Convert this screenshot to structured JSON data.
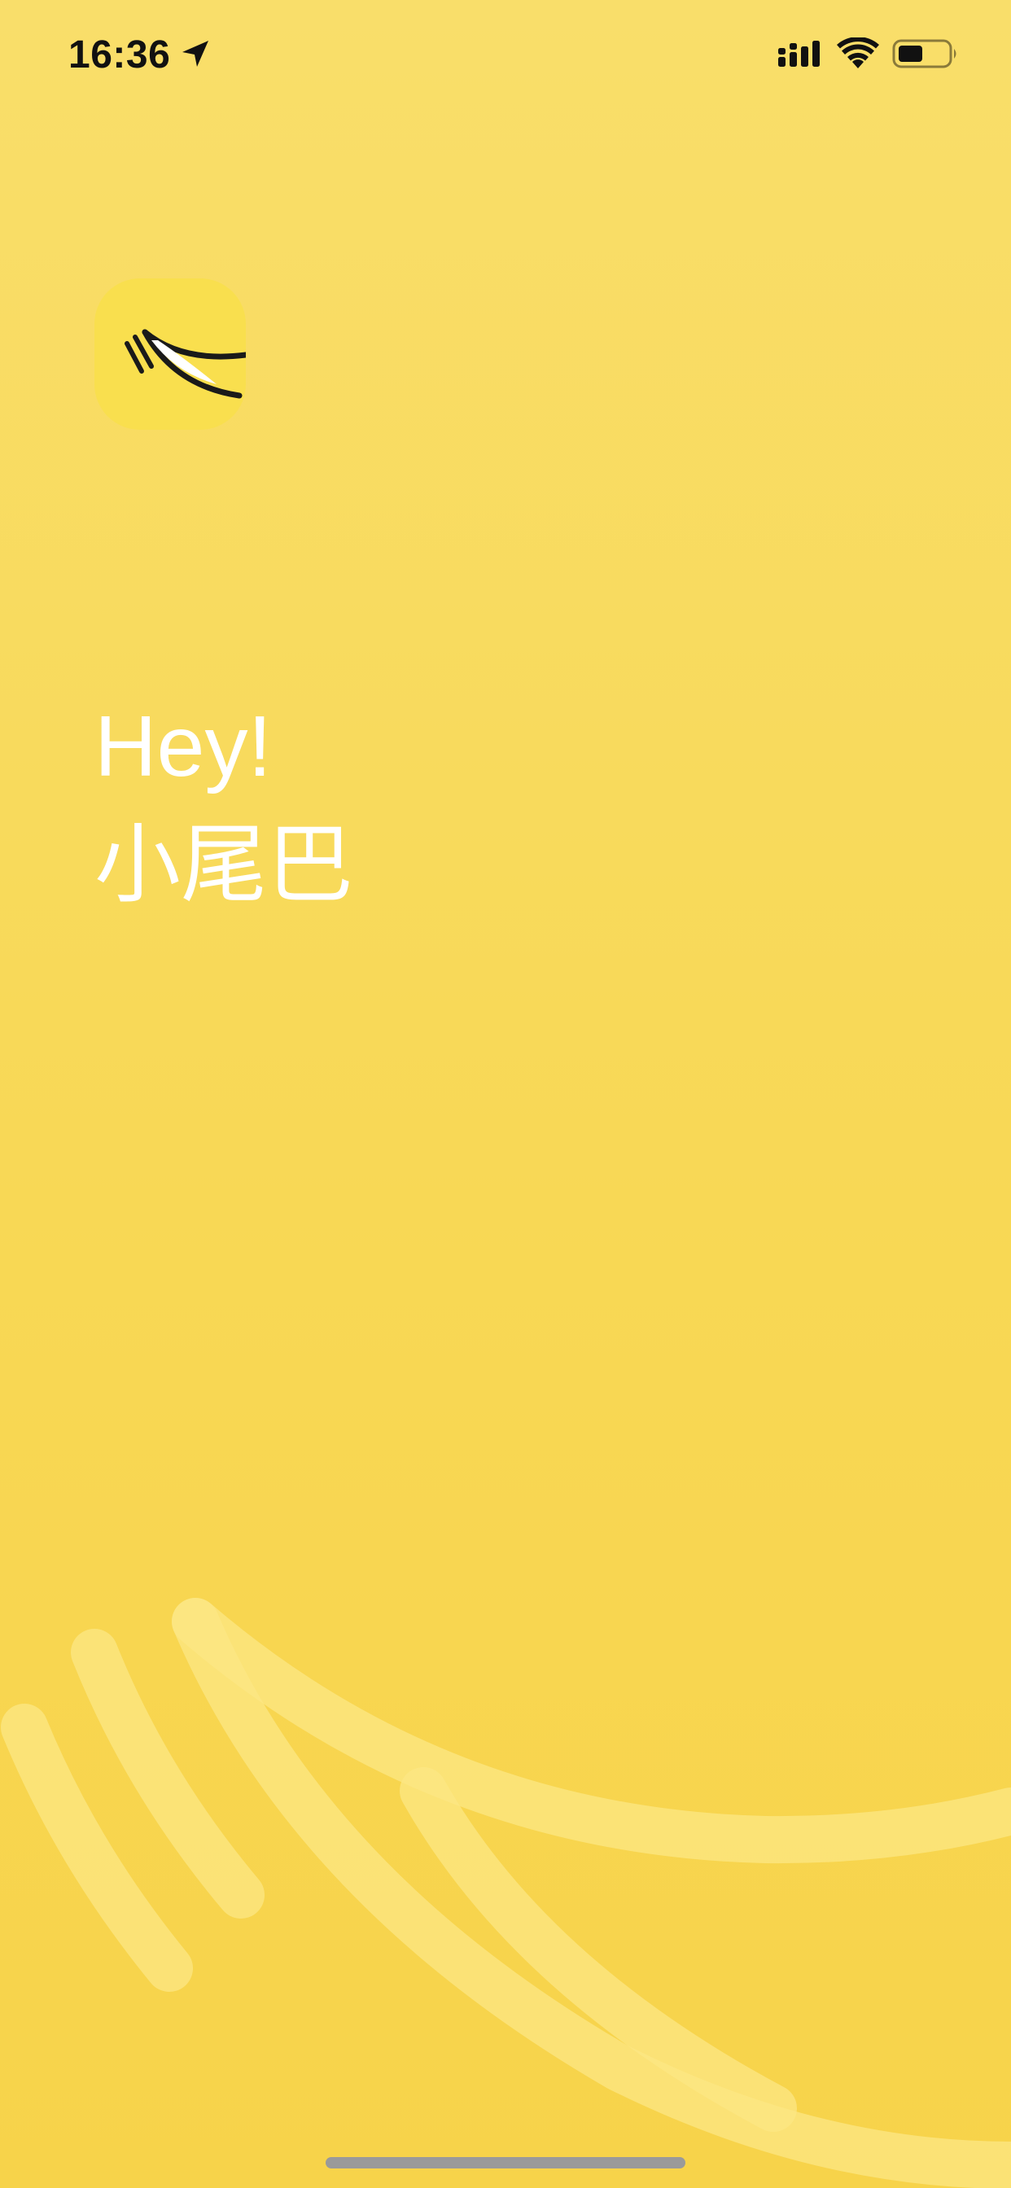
{
  "status_bar": {
    "time": "16:36",
    "location_icon": "location-arrow-icon",
    "signal_icon": "cellular-signal-icon",
    "wifi_icon": "wifi-icon",
    "battery_icon": "battery-icon",
    "battery_level": 0.5
  },
  "logo": {
    "icon": "tail-logo-icon"
  },
  "welcome": {
    "greeting": "Hey!",
    "app_name": "小尾巴"
  },
  "colors": {
    "background_top": "#F9DE6A",
    "background_bottom": "#F7D34A",
    "logo_background": "#F9DF4E",
    "text": "#FFFFFF",
    "home_indicator": "#9A9A9A"
  }
}
